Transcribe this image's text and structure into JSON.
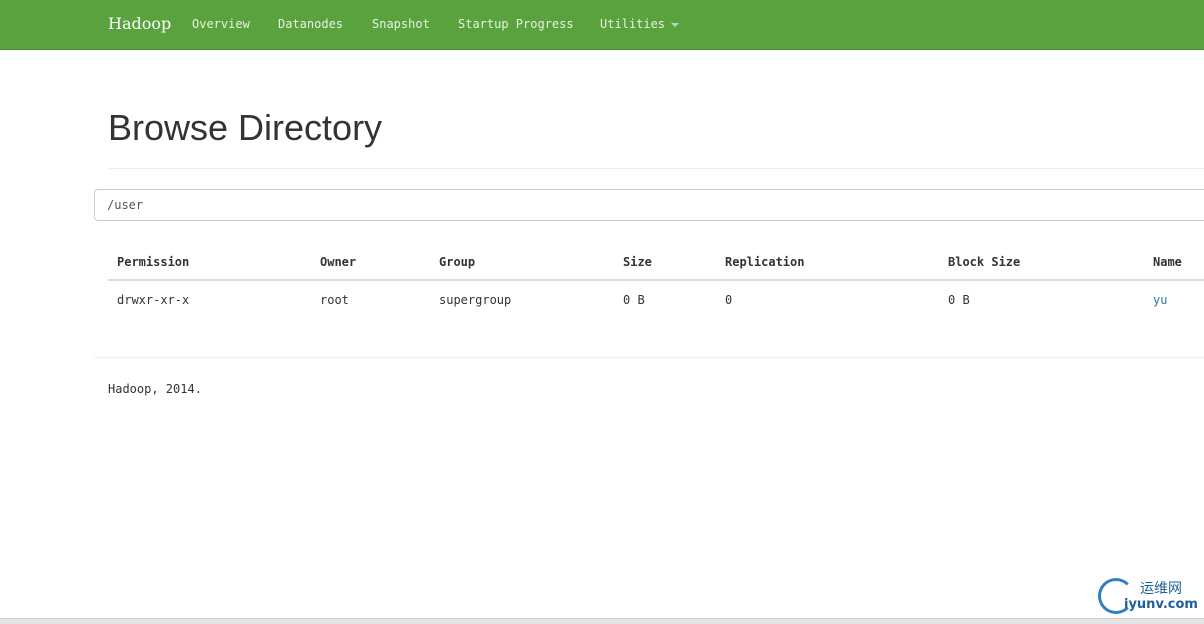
{
  "navbar": {
    "brand": "Hadoop",
    "items": [
      {
        "label": "Overview"
      },
      {
        "label": "Datanodes"
      },
      {
        "label": "Snapshot"
      },
      {
        "label": "Startup Progress"
      },
      {
        "label": "Utilities"
      }
    ],
    "background_color": "#5aa23e"
  },
  "main": {
    "title": "Browse Directory",
    "path_input": {
      "value": "/user"
    },
    "table": {
      "headers": [
        "Permission",
        "Owner",
        "Group",
        "Size",
        "Replication",
        "Block Size",
        "Name"
      ],
      "rows": [
        [
          "drwxr-xr-x",
          "root",
          "supergroup",
          "0 B",
          "0",
          "0 B",
          "yu"
        ]
      ]
    }
  },
  "footer": {
    "text": "Hadoop, 2014."
  },
  "watermark": {
    "cn": "运维网",
    "en": "iyunv.com"
  },
  "colors": {
    "link": "#2a7ab0"
  }
}
